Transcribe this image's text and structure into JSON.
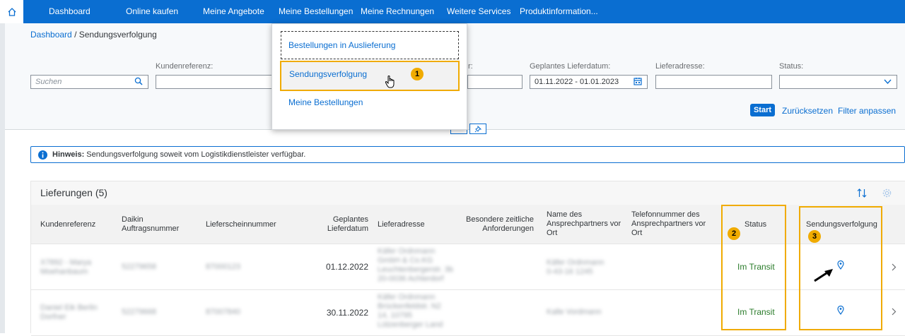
{
  "nav": {
    "items": [
      "Dashboard",
      "Online kaufen",
      "Meine Angebote",
      "Meine Bestellungen",
      "Meine Rechnungen",
      "Weitere Services",
      "Produktinformation..."
    ]
  },
  "breadcrumb": {
    "root": "Dashboard",
    "current": "/ Sendungsverfolgung"
  },
  "filters": {
    "search_placeholder": "Suchen",
    "kundenreferenz_label": "Kundenreferenz:",
    "partial_label": "r:",
    "lieferdatum_label": "Geplantes Lieferdatum:",
    "lieferdatum_value": "01.11.2022 - 01.01.2023",
    "lieferadresse_label": "Lieferadresse:",
    "status_label": "Status:",
    "start": "Start",
    "reset": "Zurücksetzen",
    "adapt": "Filter anpassen"
  },
  "menu": {
    "items": [
      "Bestellungen in Auslieferung",
      "Sendungsverfolgung",
      "Meine Bestellungen"
    ]
  },
  "callouts": [
    "1",
    "2",
    "3"
  ],
  "info": {
    "bold": "Hinweis:",
    "text": "Sendungsverfolgung soweit vom Logistikdienstleister verfügbar."
  },
  "table": {
    "title": "Lieferungen (5)",
    "headers": {
      "kundenreferenz": "Kundenreferenz",
      "auftragsnummer": [
        "Daikin",
        "Auftragsnummer"
      ],
      "lieferschein": "Lieferscheinnummer",
      "lieferdatum": [
        "Geplantes",
        "Lieferdatum"
      ],
      "lieferadresse": "Lieferadresse",
      "anforderungen": [
        "Besondere zeitliche",
        "Anforderungen"
      ],
      "ansprechpartner": [
        "Name des",
        "Ansprechpartners vor",
        "Ort"
      ],
      "telefon": [
        "Telefonnummer des",
        "Ansprechpartners vor",
        "Ort"
      ],
      "status": "Status",
      "sendung": "Sendungsverfolgung"
    },
    "rows": [
      {
        "ref": [
          "X7892 - Marya",
          "Moehanbaum"
        ],
        "auftrag": "52279658",
        "lieferschein": "87000123",
        "datum": "01.12.2022",
        "adresse": [
          "Käfer Ordnmann",
          "GmbH & Co.KG",
          "Leuchtenbergerstr. 3b",
          "20-0036 Achterdorf"
        ],
        "anspr": [
          "Käfer Ordnmann",
          "0-43-16 1245"
        ],
        "status": "Im Transit"
      },
      {
        "ref": [
          "Daniel Eik Berlin",
          "Dorfner"
        ],
        "auftrag": "52279668",
        "lieferschein": "87007840",
        "datum": "30.11.2022",
        "adresse": [
          "Käfer Ordnmann",
          "Brückenfeldstr. N2",
          "14, 10795",
          "Lützenberger Land"
        ],
        "anspr": [
          "Kalle Vordmann"
        ],
        "status": "Im Transit"
      }
    ]
  }
}
